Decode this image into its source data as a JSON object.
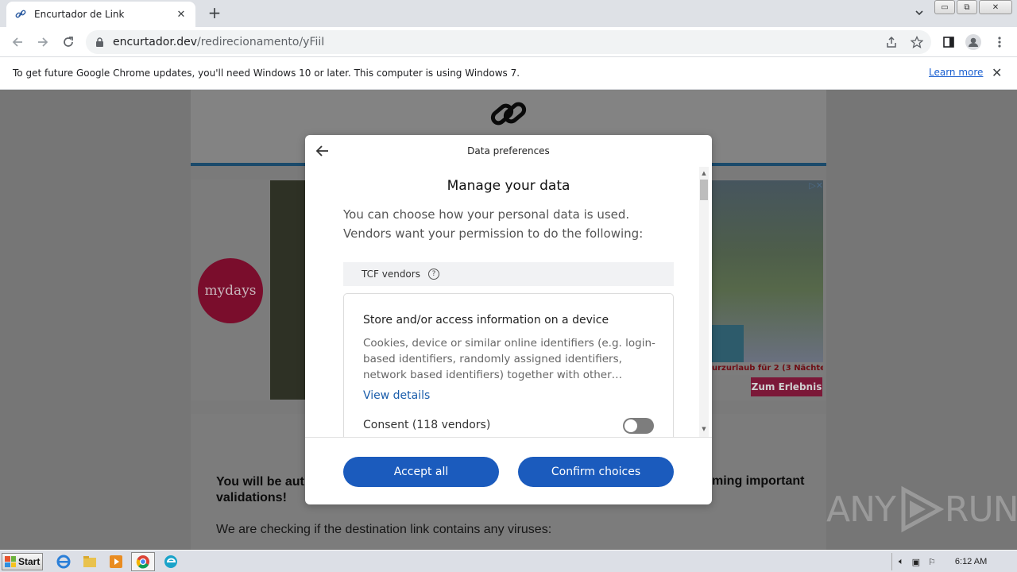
{
  "browser": {
    "tab_title": "Encurtador de Link",
    "tab_close": "✕",
    "new_tab": "+",
    "url_host": "encurtador.dev",
    "url_path": "/redirecionamento/yFiiI",
    "window_buttons": {
      "minimize": "▭",
      "maximize": "⧉",
      "close": "✕"
    }
  },
  "infobar": {
    "message": "To get future Google Chrome updates, you'll need Windows 10 or later. This computer is using Windows 7.",
    "link": "Learn more",
    "close": "✕"
  },
  "page": {
    "ad": {
      "brand": "mydays",
      "caption": "urzurlaub für 2 (3 Nächte)",
      "cta": "Zum Erlebnis",
      "adchoices": "▷✕"
    },
    "message_left": "You will be aut validations!",
    "message_left_l1": "You will be aut",
    "message_left_l2": "validations!",
    "message_right": "ming important",
    "checking": "We are checking if the destination link contains any viruses:"
  },
  "modal": {
    "header": "Data preferences",
    "heading": "Manage your data",
    "intro": "You can choose how your personal data is used. Vendors want your permission to do the following:",
    "tcf_label": "TCF vendors",
    "purpose": {
      "title": "Store and/or access information on a device",
      "description": "Cookies, device or similar online identifiers (e.g. login-based identifiers, randomly assigned identifiers, network based identifiers) together with other…",
      "link": "View details",
      "consent_label": "Consent (118 vendors)",
      "consent_enabled": false
    },
    "accept_all": "Accept all",
    "confirm_choices": "Confirm choices"
  },
  "watermark": {
    "left": "ANY",
    "right": "RUN"
  },
  "taskbar": {
    "start": "Start",
    "clock": "6:12 AM"
  },
  "colors": {
    "primary_button": "#1b5bbd",
    "link": "#1a5dab",
    "toggle_off": "#7d7d7d"
  }
}
